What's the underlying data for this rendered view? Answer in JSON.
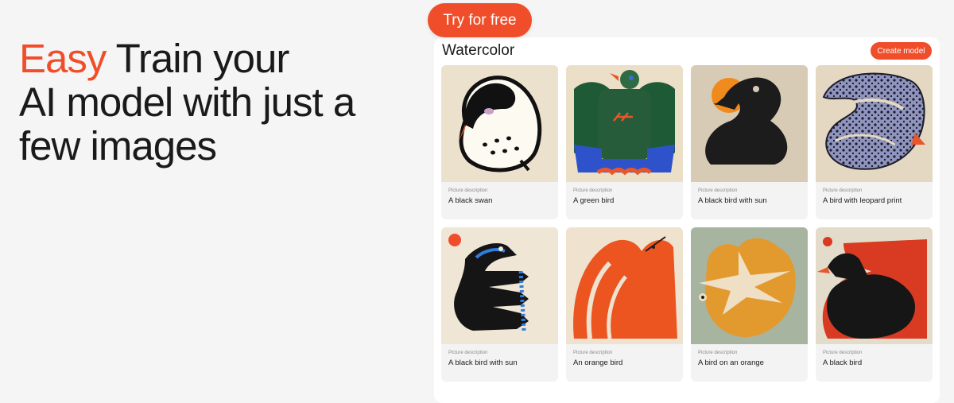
{
  "hero": {
    "accent_word": "Easy",
    "headline_line1_rest": " Train your",
    "headline_line2": "AI model with just a",
    "headline_line3": "few images"
  },
  "cta": {
    "try_label": "Try for free"
  },
  "panel": {
    "title": "Watercolor",
    "create_label": "Create model",
    "caption_label": "Picture description",
    "items": [
      {
        "description": "A black swan",
        "icon": "black-swan-art"
      },
      {
        "description": "A green bird",
        "icon": "green-bird-art"
      },
      {
        "description": "A black bird with sun",
        "icon": "black-bird-sun-art"
      },
      {
        "description": "A bird with leopard print",
        "icon": "leopard-bird-art"
      },
      {
        "description": "A black bird with sun",
        "icon": "black-bird-blue-art"
      },
      {
        "description": "An orange bird",
        "icon": "orange-bird-art"
      },
      {
        "description": "A bird on an orange",
        "icon": "bird-on-orange-art"
      },
      {
        "description": "A black bird",
        "icon": "black-bird-red-art"
      }
    ]
  },
  "colors": {
    "accent": "#f04e2a",
    "background": "#f5f5f5",
    "panel": "#ffffff"
  }
}
